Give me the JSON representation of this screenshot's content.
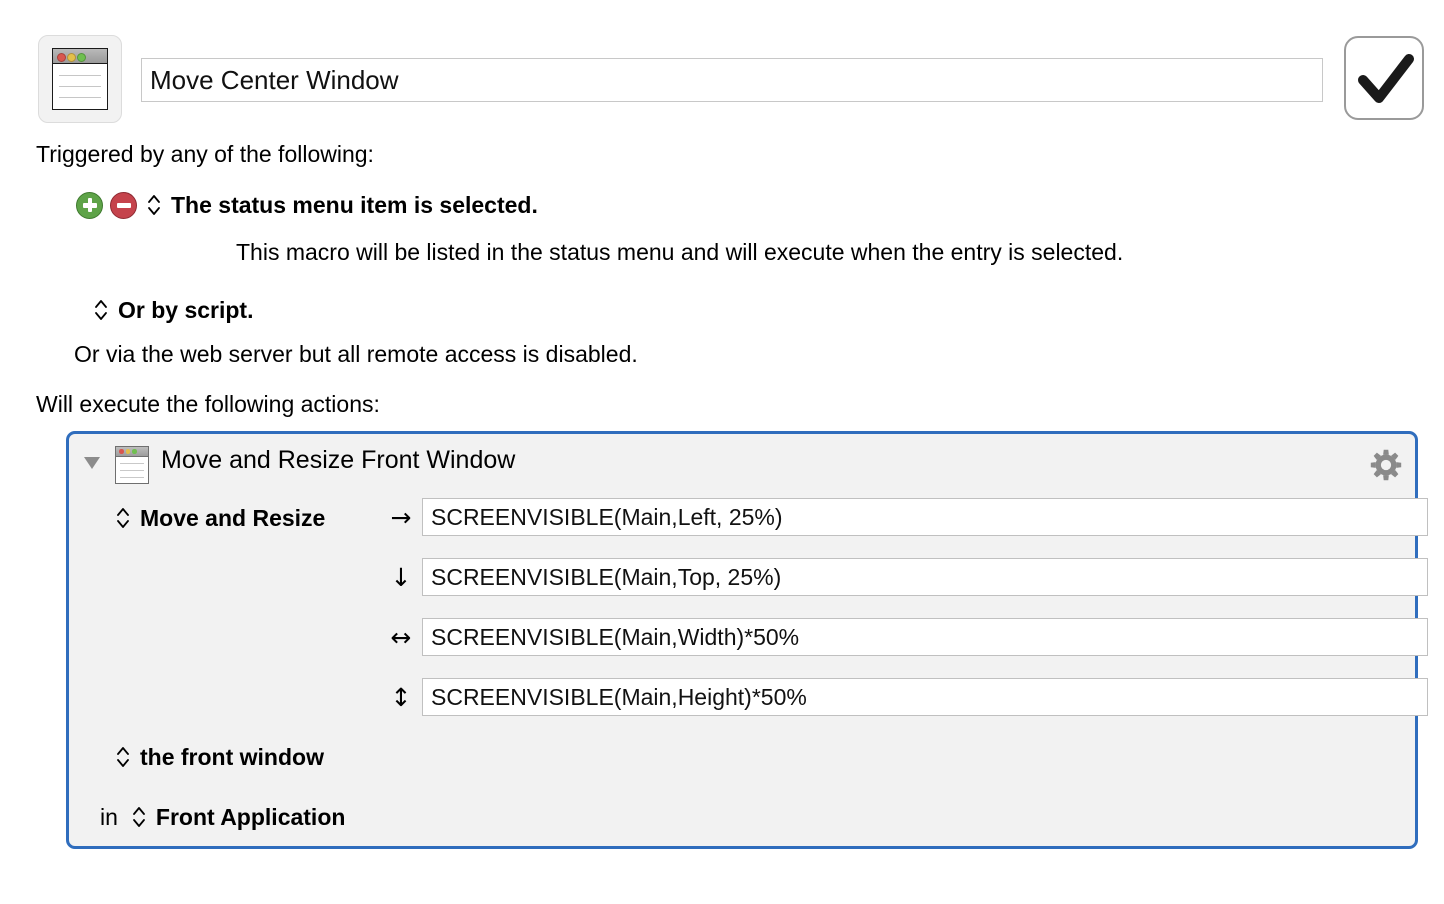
{
  "header": {
    "macro_icon": "macro-window-icon",
    "title_value": "Move Center Window",
    "title_placeholder": "Macro Name",
    "enabled_toggle_icon": "checkmark-icon"
  },
  "trigger_section": {
    "heading": "Triggered by any of the following:",
    "add_button_icon": "plus-circle-icon",
    "remove_button_icon": "minus-circle-icon",
    "trigger_selector": "The status menu item is selected.",
    "trigger_description": "This macro will be listed in the status menu and will execute when the entry is selected.",
    "script_selector": "Or by script.",
    "script_description": "Or via the web server but all remote access is disabled."
  },
  "actions_section": {
    "heading": "Will execute the following actions:",
    "action": {
      "disclosure_icon": "triangle-down-icon",
      "icon": "window-icon",
      "title": "Move and Resize Front Window",
      "gear_icon": "gear-icon",
      "operation_selector": "Move and Resize",
      "fields": [
        {
          "arrow_icon": "arrow-right-icon",
          "glyph": "→",
          "name": "left-field",
          "value": "SCREENVISIBLE(Main,Left, 25%)"
        },
        {
          "arrow_icon": "arrow-down-icon",
          "glyph": "↓",
          "name": "top-field",
          "value": "SCREENVISIBLE(Main,Top, 25%)"
        },
        {
          "arrow_icon": "arrow-left-right-icon",
          "glyph": "↔",
          "name": "width-field",
          "value": "SCREENVISIBLE(Main,Width)*50%"
        },
        {
          "arrow_icon": "arrow-up-down-icon",
          "glyph": "↕",
          "name": "height-field",
          "value": "SCREENVISIBLE(Main,Height)*50%"
        }
      ],
      "target_selector": "the front window",
      "application_prefix": "in",
      "application_selector": "Front Application"
    }
  },
  "colors": {
    "panel_border": "#2f6dbd",
    "panel_background": "#f2f2f2",
    "add_green": "#5ea348",
    "remove_red": "#c5434c",
    "gear_gray": "#8a8a8a",
    "page_background": "#ffffff"
  }
}
